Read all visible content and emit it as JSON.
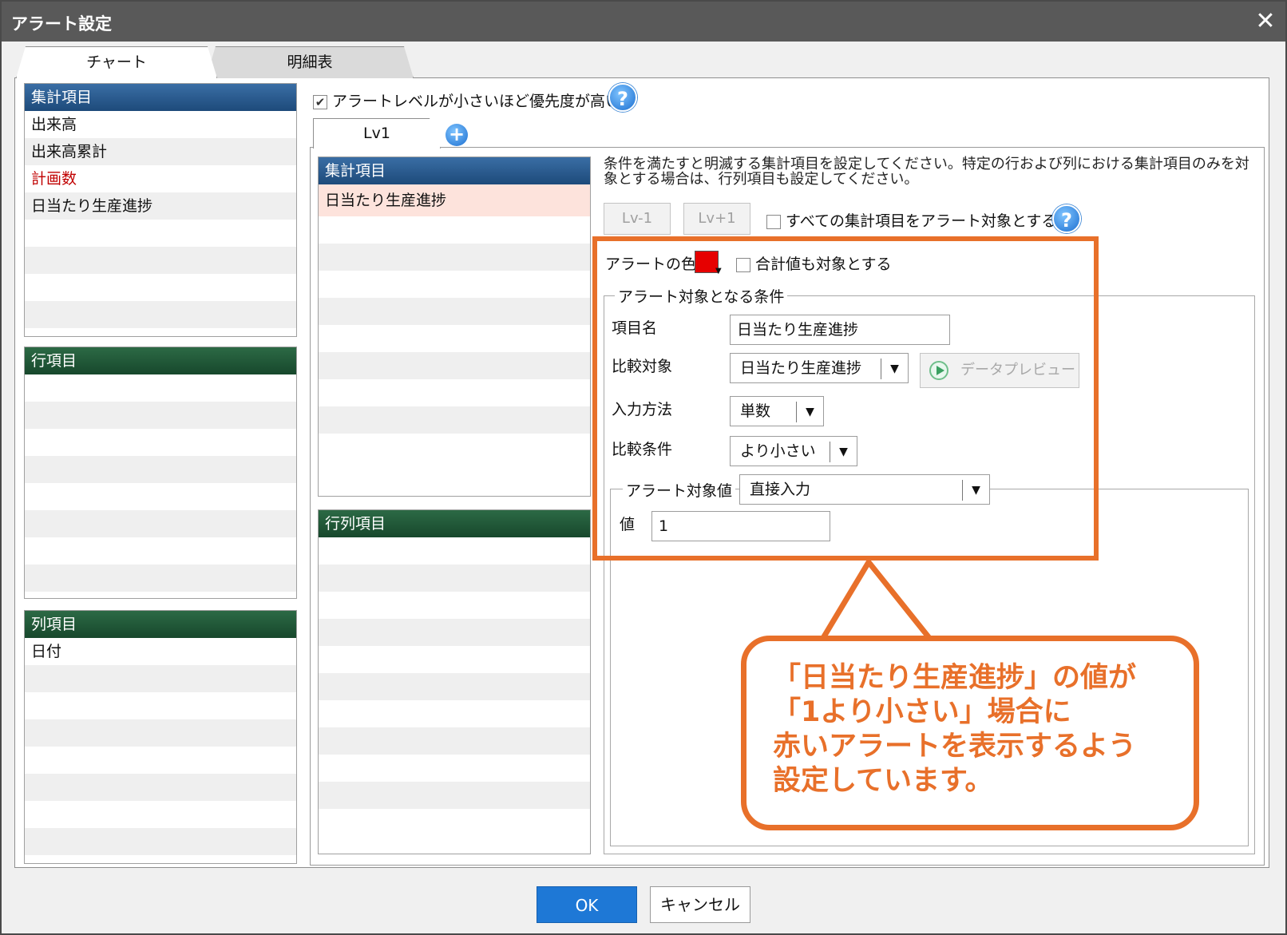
{
  "window": {
    "title": "アラート設定"
  },
  "tabs": [
    {
      "label": "チャート"
    },
    {
      "label": "明細表"
    }
  ],
  "left": {
    "aggregate": {
      "header": "集計項目",
      "items": [
        "出来高",
        "出来高累計",
        "計画数",
        "日当たり生産進捗"
      ]
    },
    "row": {
      "header": "行項目"
    },
    "column": {
      "header": "列項目",
      "items": [
        "日付"
      ]
    }
  },
  "priority_checkbox": {
    "label": "アラートレベルが小さいほど優先度が高い",
    "checked": true
  },
  "level_tab": {
    "label": "Lv1"
  },
  "mid": {
    "aggregate": {
      "header": "集計項目",
      "selected": "日当たり生産進捗"
    },
    "rowcol": {
      "header": "行列項目"
    }
  },
  "description": "条件を満たすと明滅する集計項目を設定してください。特定の行および列における集計項目のみを対象とする場合は、行列項目も設定してください。",
  "level_buttons": {
    "minus": "Lv-1",
    "plus": "Lv+1"
  },
  "all_checkbox": {
    "label": "すべての集計項目をアラート対象とする",
    "checked": false
  },
  "alert": {
    "color_label": "アラートの色",
    "color": "#e60000",
    "total_checkbox": "合計値も対象とする",
    "condition_group": "アラート対象となる条件",
    "item_name_label": "項目名",
    "item_name_value": "日当たり生産進捗",
    "compare_target_label": "比較対象",
    "compare_target_value": "日当たり生産進捗",
    "preview_button": "データプレビュー",
    "input_method_label": "入力方法",
    "input_method_value": "単数",
    "compare_condition_label": "比較条件",
    "compare_condition_value": "より小さい",
    "target_value_label": "アラート対象値",
    "target_value_mode": "直接入力",
    "value_label": "値",
    "value": "1"
  },
  "callout": {
    "line1": "「日当たり生産進捗」の値が",
    "line2": "「1より小さい」場合に",
    "line3": "赤いアラートを表示するよう",
    "line4": "設定しています。",
    "color": "#e8702a"
  },
  "footer": {
    "ok": "OK",
    "cancel": "キャンセル"
  }
}
